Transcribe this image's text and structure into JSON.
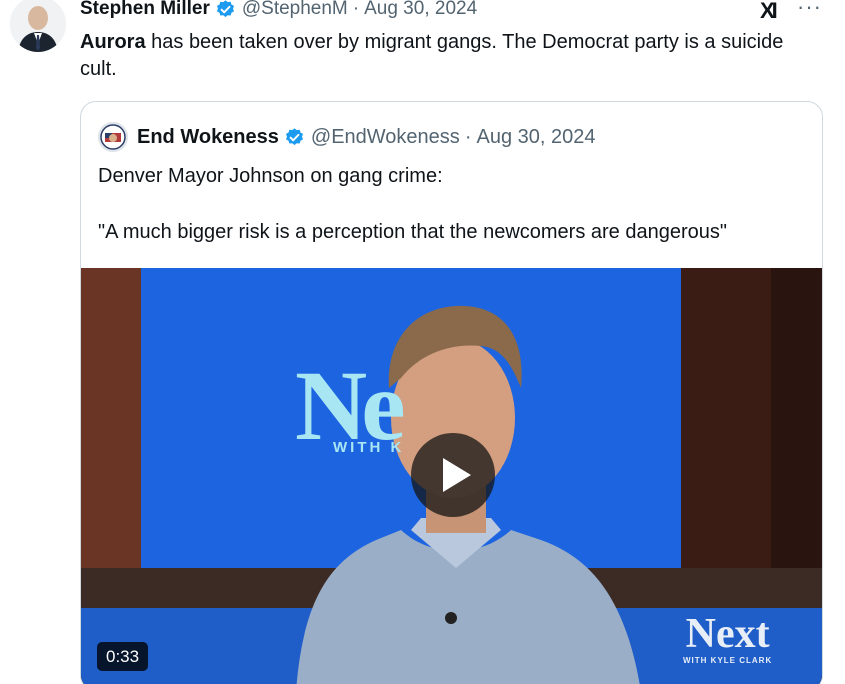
{
  "tweet": {
    "author_name": "Stephen Miller",
    "handle": "@StephenM",
    "separator": "·",
    "date": "Aug 30, 2024",
    "text_bold": "Aurora",
    "text_rest": " has been taken over by migrant gangs. The Democrat party is a suicide cult.",
    "more_label": "···",
    "platform_logo": "XI"
  },
  "quote": {
    "author_name": "End Wokeness",
    "handle": "@EndWokeness",
    "separator": "·",
    "date": "Aug 30, 2024",
    "text_line1": "Denver Mayor Johnson on gang crime:",
    "text_line2": "\"A much bigger risk is a perception that the newcomers are dangerous\"",
    "video": {
      "duration": "0:33",
      "backdrop_word": "Ne",
      "backdrop_sub": "WITH K",
      "bug_word": "Next",
      "bug_sub": "WITH KYLE CLARK"
    }
  },
  "colors": {
    "verified": "#1d9bf0",
    "secondary_text": "#536471",
    "studio_blue": "#1d64e0",
    "wall_brick": "#5a2a20"
  },
  "icons": {
    "verified": "verified-badge-icon",
    "more": "more-options-icon",
    "play": "play-icon",
    "logo": "x-logo-icon"
  }
}
